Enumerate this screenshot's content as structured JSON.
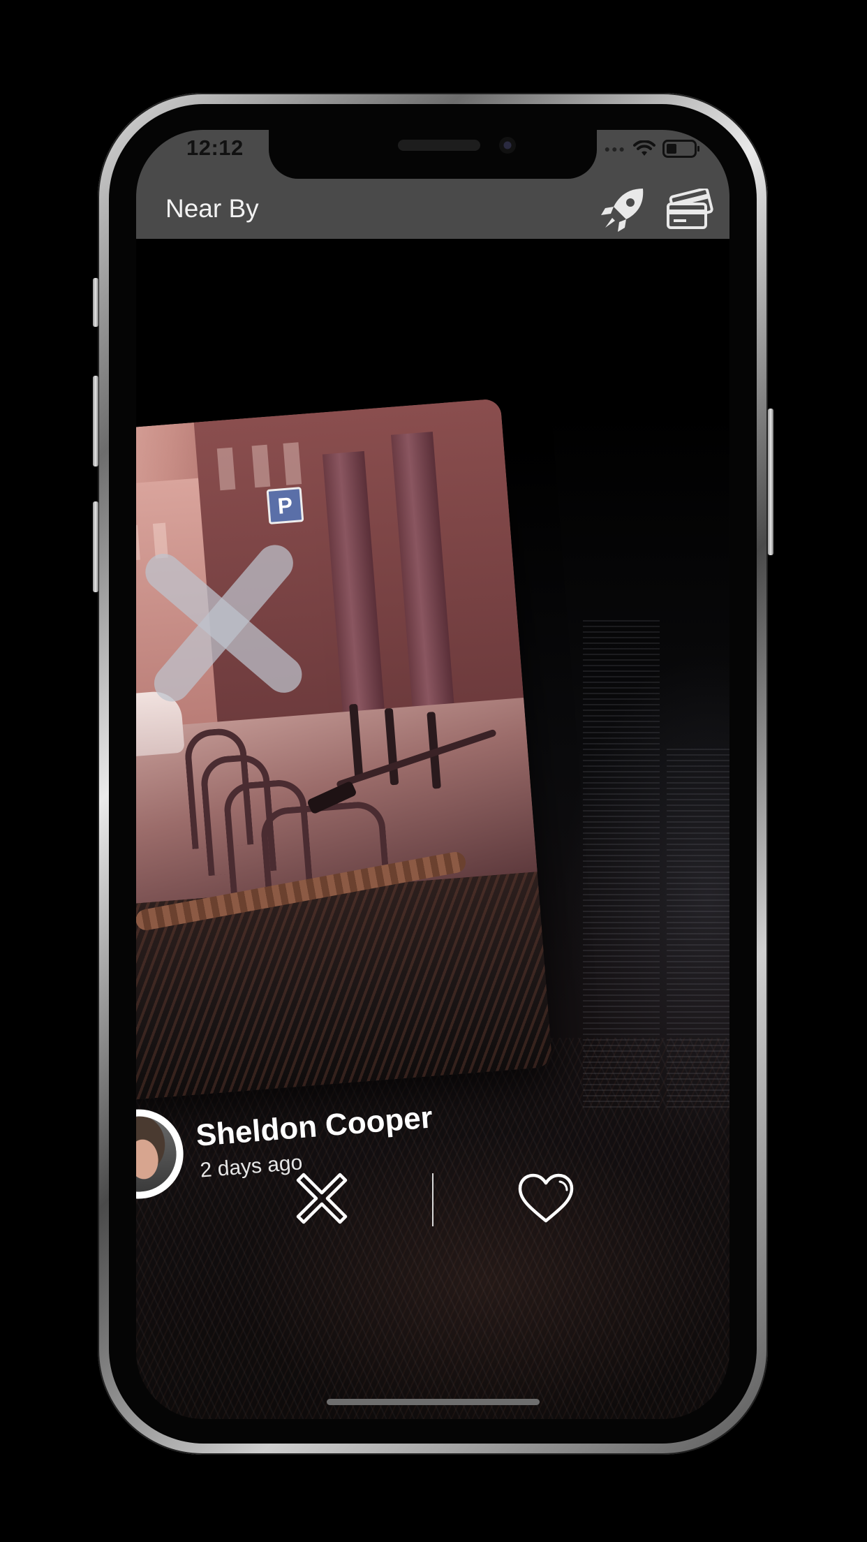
{
  "status_bar": {
    "time": "12:12"
  },
  "nav": {
    "title": "Near By",
    "boost_icon": "rocket-icon",
    "wallet_icon": "credit-cards-icon"
  },
  "card": {
    "user_name": "Sheldon Cooper",
    "posted": "2 days ago",
    "overlay_icon": "reject-x-icon"
  },
  "actions": {
    "dislike_icon": "close-icon",
    "like_icon": "heart-icon"
  },
  "colors": {
    "nav_bar": "#4a4a4a",
    "card_tint": "#9a5b58",
    "icon_light": "#ffffff"
  }
}
